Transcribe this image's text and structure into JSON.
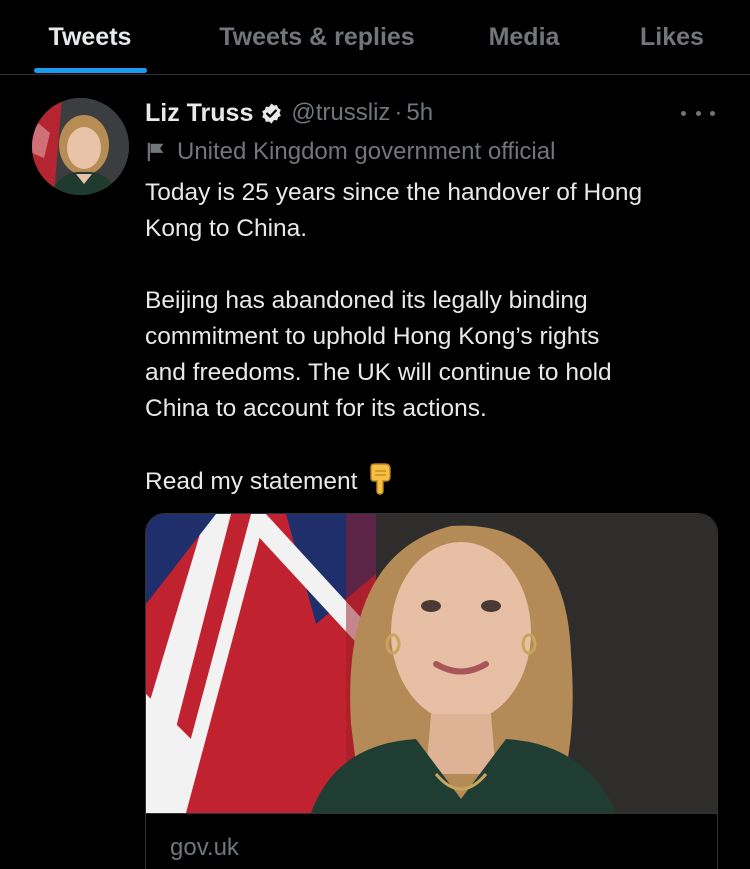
{
  "tabs": [
    {
      "label": "Tweets",
      "active": true
    },
    {
      "label": "Tweets & replies",
      "active": false
    },
    {
      "label": "Media",
      "active": false
    },
    {
      "label": "Likes",
      "active": false
    }
  ],
  "tweet": {
    "author_name": "Liz Truss",
    "handle": "@trussliz",
    "separator": "·",
    "time": "5h",
    "label": "United Kingdom government official",
    "text_lines": [
      "Today is 25 years since the handover of Hong",
      "Kong to China.",
      "Beijing has abandoned its legally binding",
      "commitment to uphold Hong Kong’s rights",
      "and freedoms. The UK will continue to hold",
      "China to account for its actions.",
      "Read my statement"
    ],
    "card": {
      "domain": "gov.uk"
    }
  },
  "icons": {
    "verified": "verified-badge-icon",
    "label": "flag-icon",
    "more": "more-icon",
    "point_down": "backhand-index-pointing-down-icon"
  },
  "colors": {
    "background": "#000000",
    "text": "#e7e9ea",
    "secondary": "#71767b",
    "accent": "#1d9bf0",
    "border": "#2f3336"
  }
}
